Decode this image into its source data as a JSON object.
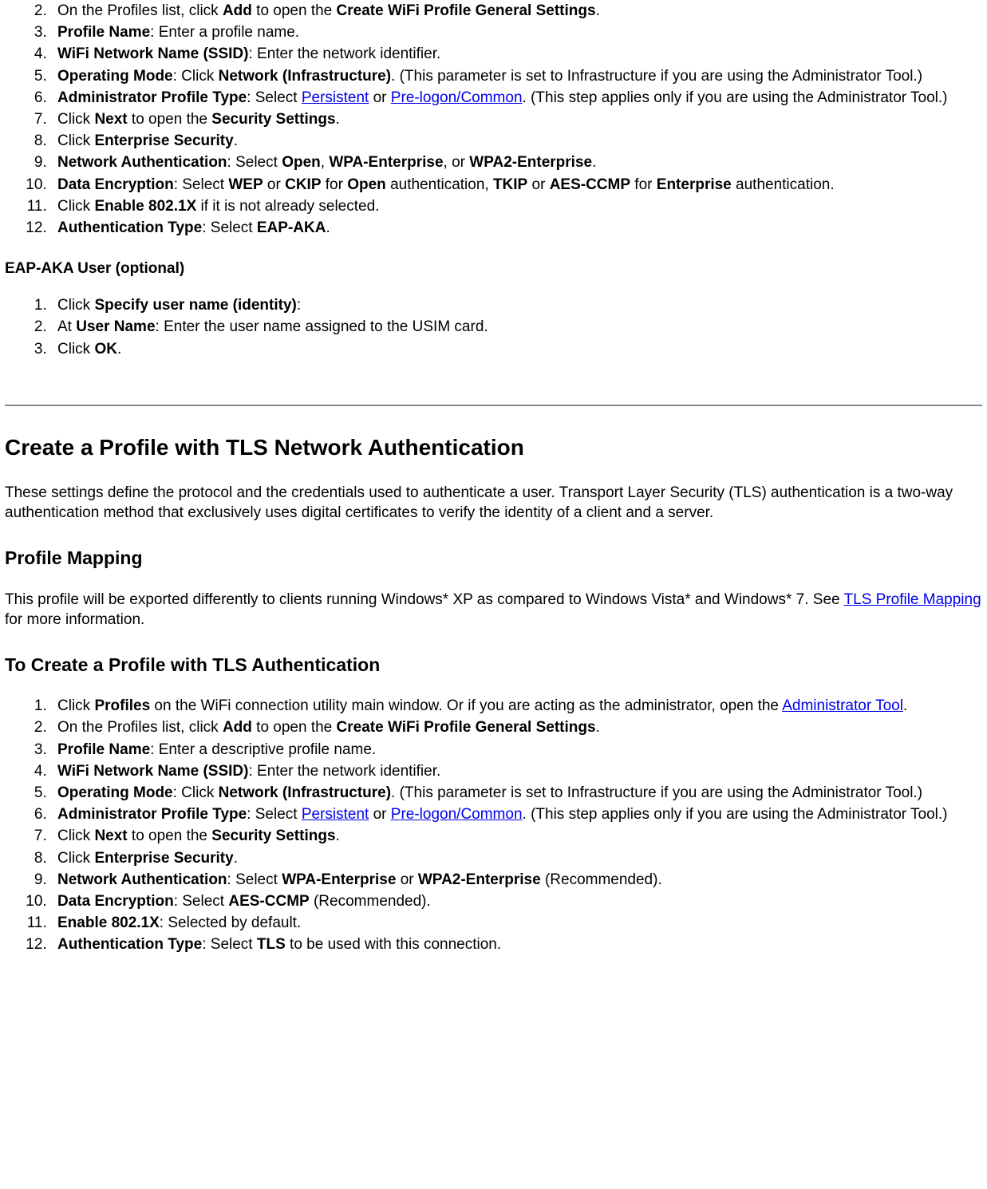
{
  "ol1": {
    "start": 2,
    "items": [
      {
        "pre": "On the Profiles list, click ",
        "b1": "Add",
        "mid": " to open the ",
        "b2": "Create WiFi Profile General Settings",
        "post": "."
      },
      {
        "b1": "Profile Name",
        "post": ": Enter a profile name."
      },
      {
        "b1": "WiFi Network Name (SSID)",
        "post": ": Enter the network identifier."
      },
      {
        "b1": "Operating Mode",
        "mid": ": Click ",
        "b2": "Network (Infrastructure)",
        "post": ". (This parameter is set to Infrastructure if you are using the Administrator Tool.)"
      },
      {
        "b1": "Administrator Profile Type",
        "mid": ": Select ",
        "a1": "Persistent",
        "mid2": " or ",
        "a2": "Pre-logon/Common",
        "post": ". (This step applies only if you are using the Administrator Tool.)"
      },
      {
        "pre": "Click ",
        "b1": "Next",
        "mid": " to open the ",
        "b2": "Security Settings",
        "post": "."
      },
      {
        "pre": "Click ",
        "b1": "Enterprise Security",
        "post": "."
      },
      {
        "b1": "Network Authentication",
        "mid": ": Select ",
        "b2": "Open",
        "mid2": ", ",
        "b3": "WPA-Enterprise",
        "mid3": ", or ",
        "b4": "WPA2-Enterprise",
        "post": "."
      },
      {
        "b1": "Data Encryption",
        "mid": ": Select ",
        "b2": "WEP",
        "mid2": " or ",
        "b3": "CKIP",
        "mid3": " for ",
        "b4": "Open",
        "mid4": " authentication, ",
        "b5": "TKIP",
        "mid5": " or ",
        "b6": "AES-CCMP",
        "mid6": " for ",
        "b7": "Enterprise",
        "post": " authentication."
      },
      {
        "pre": "Click ",
        "b1": "Enable 802.1X",
        "post": " if it is not already selected."
      },
      {
        "b1": "Authentication Type",
        "mid": ": Select ",
        "b2": "EAP-AKA",
        "post": "."
      }
    ]
  },
  "subheading1": "EAP-AKA User (optional)",
  "ol2": {
    "items": [
      {
        "pre": "Click ",
        "b1": "Specify user name (identity)",
        "post": ":"
      },
      {
        "pre": "At ",
        "b1": "User Name",
        "post": ": Enter the user name assigned to the USIM card."
      },
      {
        "pre": "Click ",
        "b1": "OK",
        "post": "."
      }
    ]
  },
  "h2": "Create a Profile with TLS Network Authentication",
  "p1": "These settings define the protocol and the credentials used to authenticate a user. Transport Layer Security (TLS) authentication is a two-way authentication method that exclusively uses digital certificates to verify the identity of a client and a server.",
  "h3_1": "Profile Mapping",
  "p2_pre": "This profile will be exported differently to clients running Windows* XP as compared to Windows Vista* and Windows* 7. See ",
  "p2_link": "TLS Profile Mapping",
  "p2_post": " for more information.",
  "h3_2": "To Create a Profile with TLS Authentication",
  "ol3": {
    "items": [
      {
        "pre": "Click ",
        "b1": "Profiles",
        "mid": " on the WiFi connection utility main window. Or if you are acting as the administrator, open the ",
        "a1": "Administrator Tool",
        "post": "."
      },
      {
        "pre": "On the Profiles list, click ",
        "b1": "Add",
        "mid": " to open the ",
        "b2": "Create WiFi Profile General Settings",
        "post": "."
      },
      {
        "b1": "Profile Name",
        "post": ": Enter a descriptive profile name."
      },
      {
        "b1": "WiFi Network Name (SSID)",
        "post": ": Enter the network identifier."
      },
      {
        "b1": "Operating Mode",
        "mid": ": Click ",
        "b2": "Network (Infrastructure)",
        "post": ". (This parameter is set to Infrastructure if you are using the Administrator Tool.)"
      },
      {
        "b1": "Administrator Profile Type",
        "mid": ": Select ",
        "a1": "Persistent",
        "mid2": " or ",
        "a2": "Pre-logon/Common",
        "post": ". (This step applies only if you are using the Administrator Tool.)"
      },
      {
        "pre": "Click ",
        "b1": "Next",
        "mid": " to open the ",
        "b2": "Security Settings",
        "post": "."
      },
      {
        "pre": "Click ",
        "b1": "Enterprise Security",
        "post": "."
      },
      {
        "b1": "Network Authentication",
        "mid": ": Select ",
        "b2": "WPA-Enterprise",
        "mid2": " or ",
        "b3": "WPA2-Enterprise",
        "post": " (Recommended)."
      },
      {
        "b1": "Data Encryption",
        "mid": ": Select ",
        "b2": "AES-CCMP",
        "post": " (Recommended)."
      },
      {
        "b1": "Enable 802.1X",
        "post": ": Selected by default."
      },
      {
        "b1": "Authentication Type",
        "mid": ": Select ",
        "b2": "TLS",
        "post": " to be used with this connection."
      }
    ]
  }
}
